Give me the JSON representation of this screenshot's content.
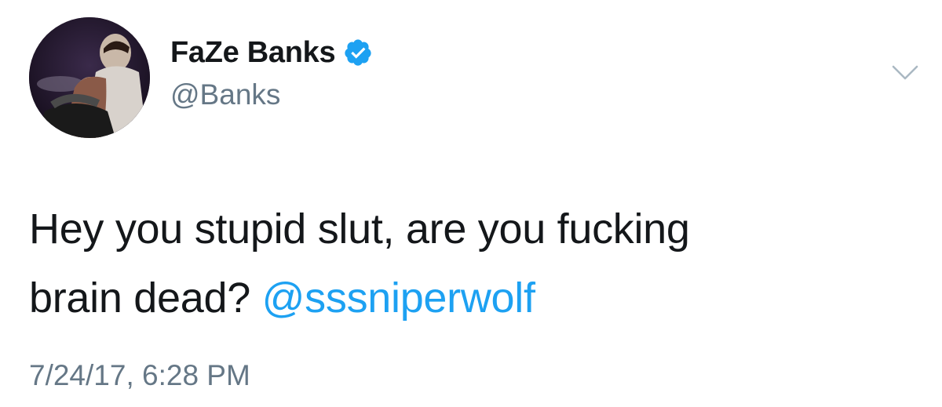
{
  "user": {
    "display_name": "FaZe Banks",
    "handle": "@Banks",
    "verified": true
  },
  "tweet": {
    "text_line1": "Hey you stupid slut, are you fucking",
    "text_line2": "brain dead?",
    "mention": "@sssniperwolf",
    "timestamp": "7/24/17, 6:28 PM"
  },
  "icons": {
    "verified": "verified-badge-icon",
    "menu": "chevron-down-icon"
  },
  "colors": {
    "name": "#14171a",
    "secondary": "#657786",
    "link": "#1da1f2",
    "verified": "#1da1f2"
  }
}
